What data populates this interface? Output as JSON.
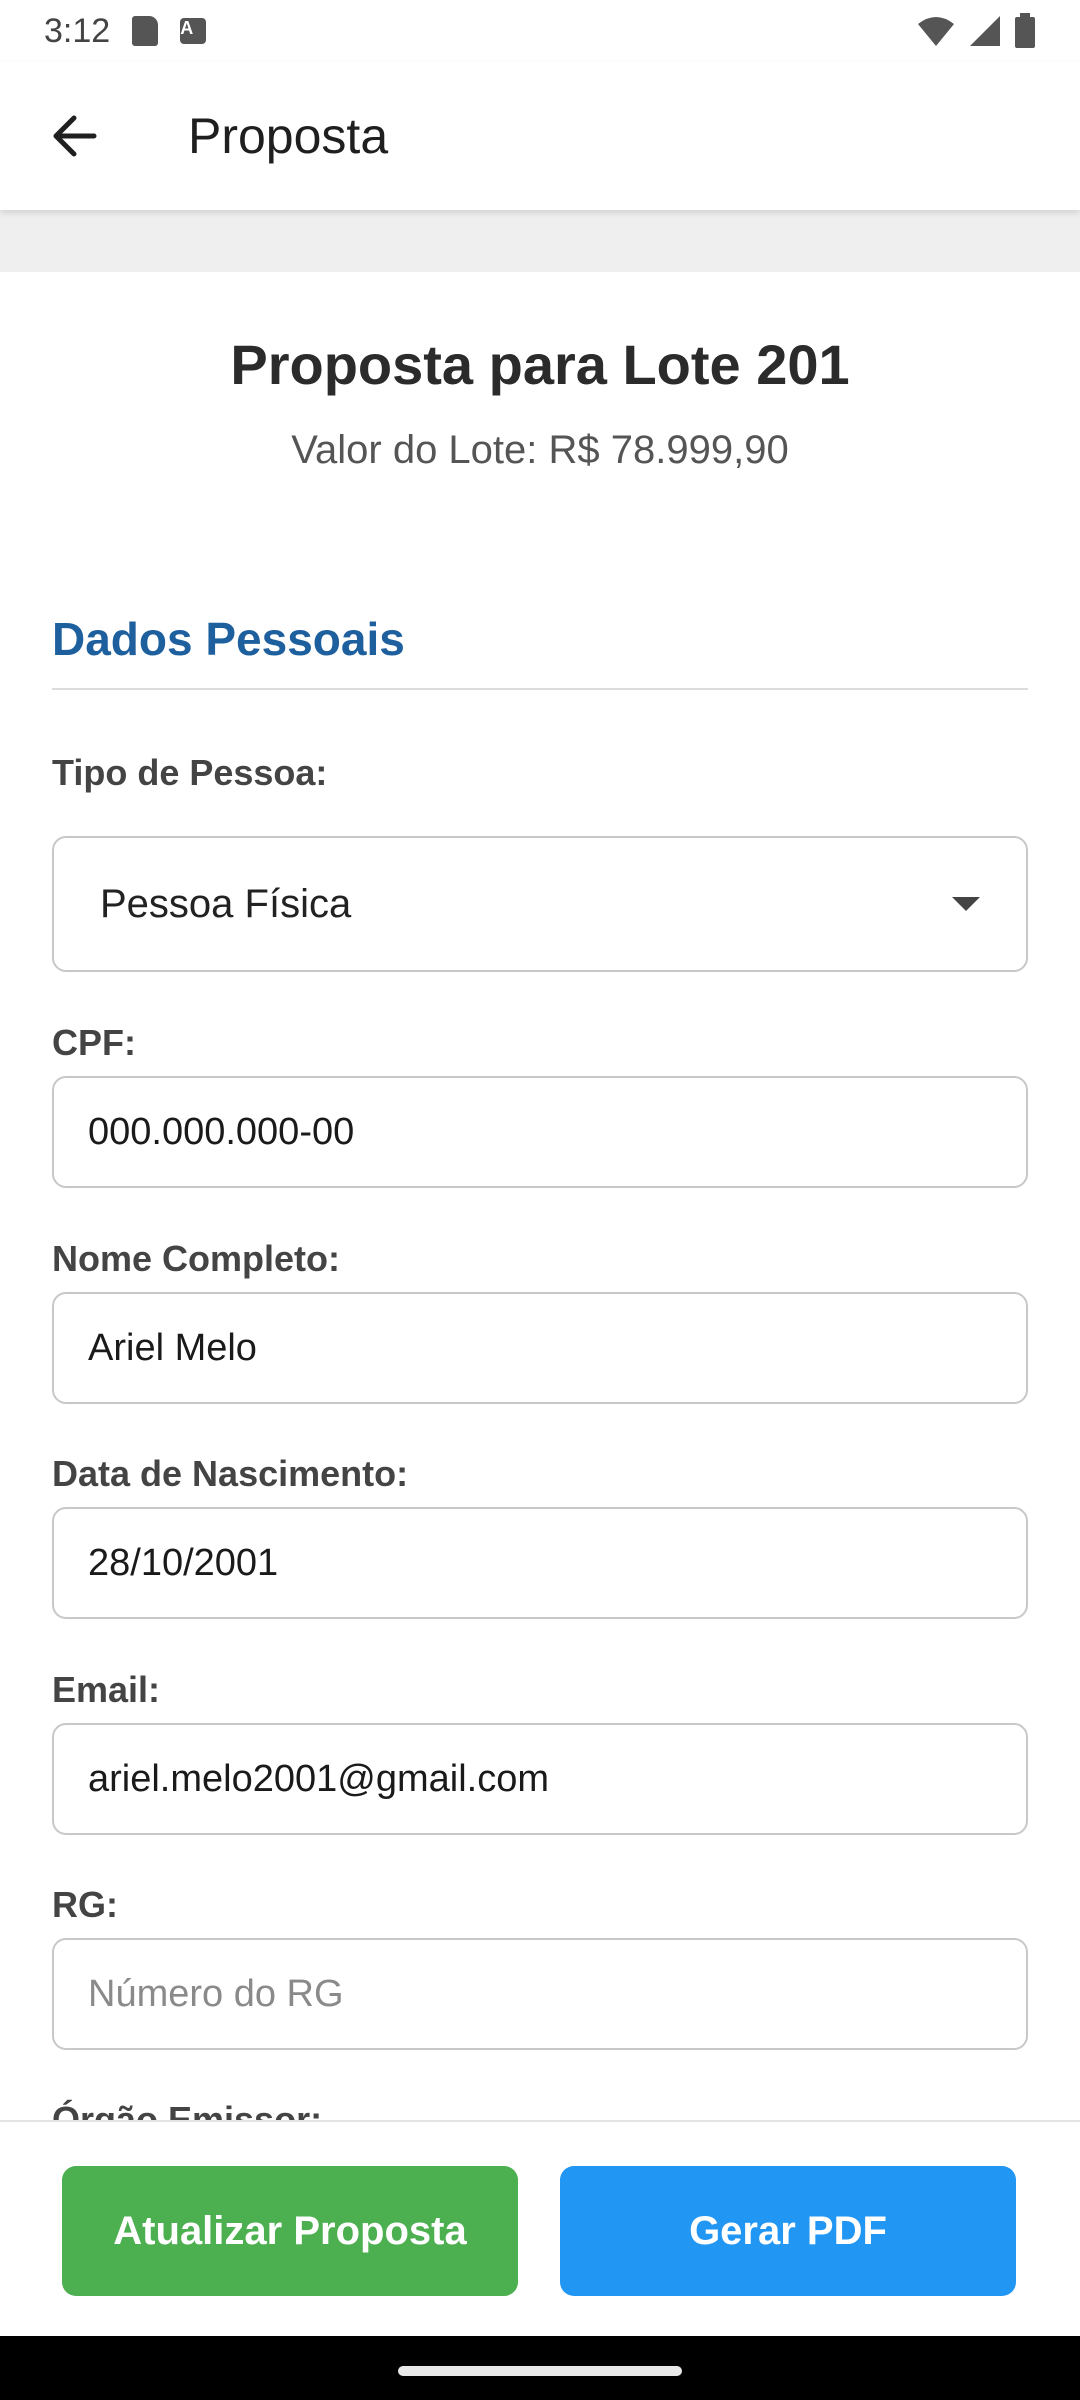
{
  "status_bar": {
    "time": "3:12",
    "icons": [
      "sd-card-icon",
      "text-a-icon",
      "wifi-icon",
      "signal-icon",
      "battery-icon"
    ]
  },
  "app_bar": {
    "title": "Proposta",
    "back_icon": "arrow-left-icon"
  },
  "main": {
    "heading": "Proposta para Lote 201",
    "subheading": "Valor do Lote: R$ 78.999,90",
    "section_title": "Dados Pessoais",
    "fields": {
      "tipo_pessoa": {
        "label": "Tipo de Pessoa:",
        "value": "Pessoa Física"
      },
      "cpf": {
        "label": "CPF:",
        "value": "000.000.000-00"
      },
      "nome": {
        "label": "Nome Completo:",
        "value": "Ariel Melo"
      },
      "nascimento": {
        "label": "Data de Nascimento:",
        "value": "28/10/2001"
      },
      "email": {
        "label": "Email:",
        "value": "ariel.melo2001@gmail.com"
      },
      "rg": {
        "label": "RG:",
        "placeholder": "Número do RG"
      },
      "orgao": {
        "label": "Órgão Emissor:"
      }
    }
  },
  "actions": {
    "update_label": "Atualizar Proposta",
    "pdf_label": "Gerar PDF"
  },
  "colors": {
    "section_title": "#1e5f9e",
    "update_button": "#4caf50",
    "pdf_button": "#2196f3"
  }
}
